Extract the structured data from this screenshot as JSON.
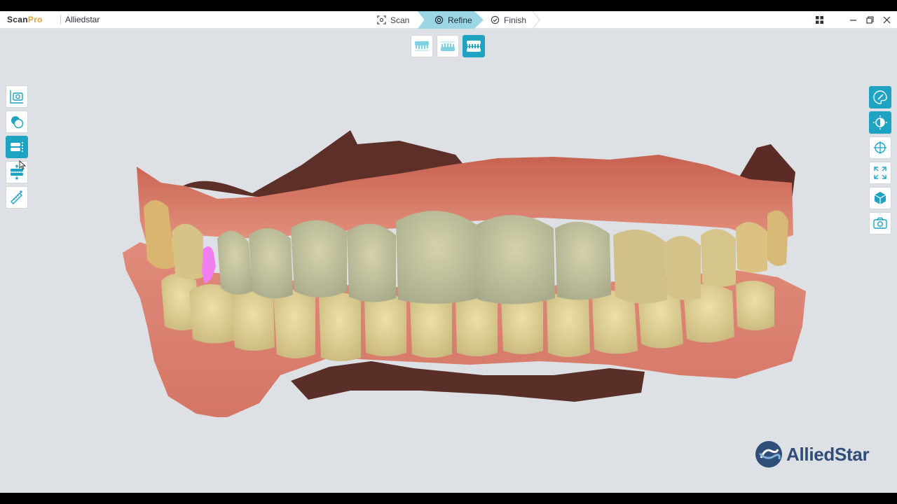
{
  "app": {
    "logo_part1": "Scan",
    "logo_part2": "Pro",
    "brand": "Alliedstar"
  },
  "workflow": {
    "steps": [
      {
        "label": "Scan",
        "icon": "scan-frame-icon",
        "active": false
      },
      {
        "label": "Refine",
        "icon": "target-icon",
        "active": true
      },
      {
        "label": "Finish",
        "icon": "check-circle-icon",
        "active": false
      }
    ]
  },
  "window_controls": [
    "grid-icon",
    "minimize-icon",
    "restore-icon",
    "close-icon"
  ],
  "jaw_selector": [
    {
      "icon": "upper-jaw-icon",
      "active": false
    },
    {
      "icon": "lower-jaw-icon",
      "active": false
    },
    {
      "icon": "both-jaws-icon",
      "active": true
    }
  ],
  "left_tools": [
    {
      "icon": "snapshot-icon",
      "active": false
    },
    {
      "icon": "overlap-circles-icon",
      "active": false
    },
    {
      "icon": "bite-icon",
      "active": true
    },
    {
      "icon": "occlusion-align-icon",
      "active": false
    },
    {
      "icon": "measure-ruler-icon",
      "active": false
    }
  ],
  "right_tools": [
    {
      "icon": "texture-palette-icon",
      "active": true
    },
    {
      "icon": "contrast-icon",
      "active": true
    },
    {
      "icon": "crosshair-icon",
      "active": false
    },
    {
      "icon": "fit-view-icon",
      "active": false
    },
    {
      "icon": "cube-view-icon",
      "active": false
    },
    {
      "icon": "camera-icon",
      "active": false
    }
  ],
  "watermark": {
    "text": "AlliedStar"
  },
  "colors": {
    "accent": "#1ea3c2",
    "step_active_bg": "#9ad6e4",
    "viewport_bg": "#dde0e5",
    "watermark": "#2f4d78",
    "logo_accent": "#e7a23a",
    "highlight_marker": "#f27ff0"
  }
}
